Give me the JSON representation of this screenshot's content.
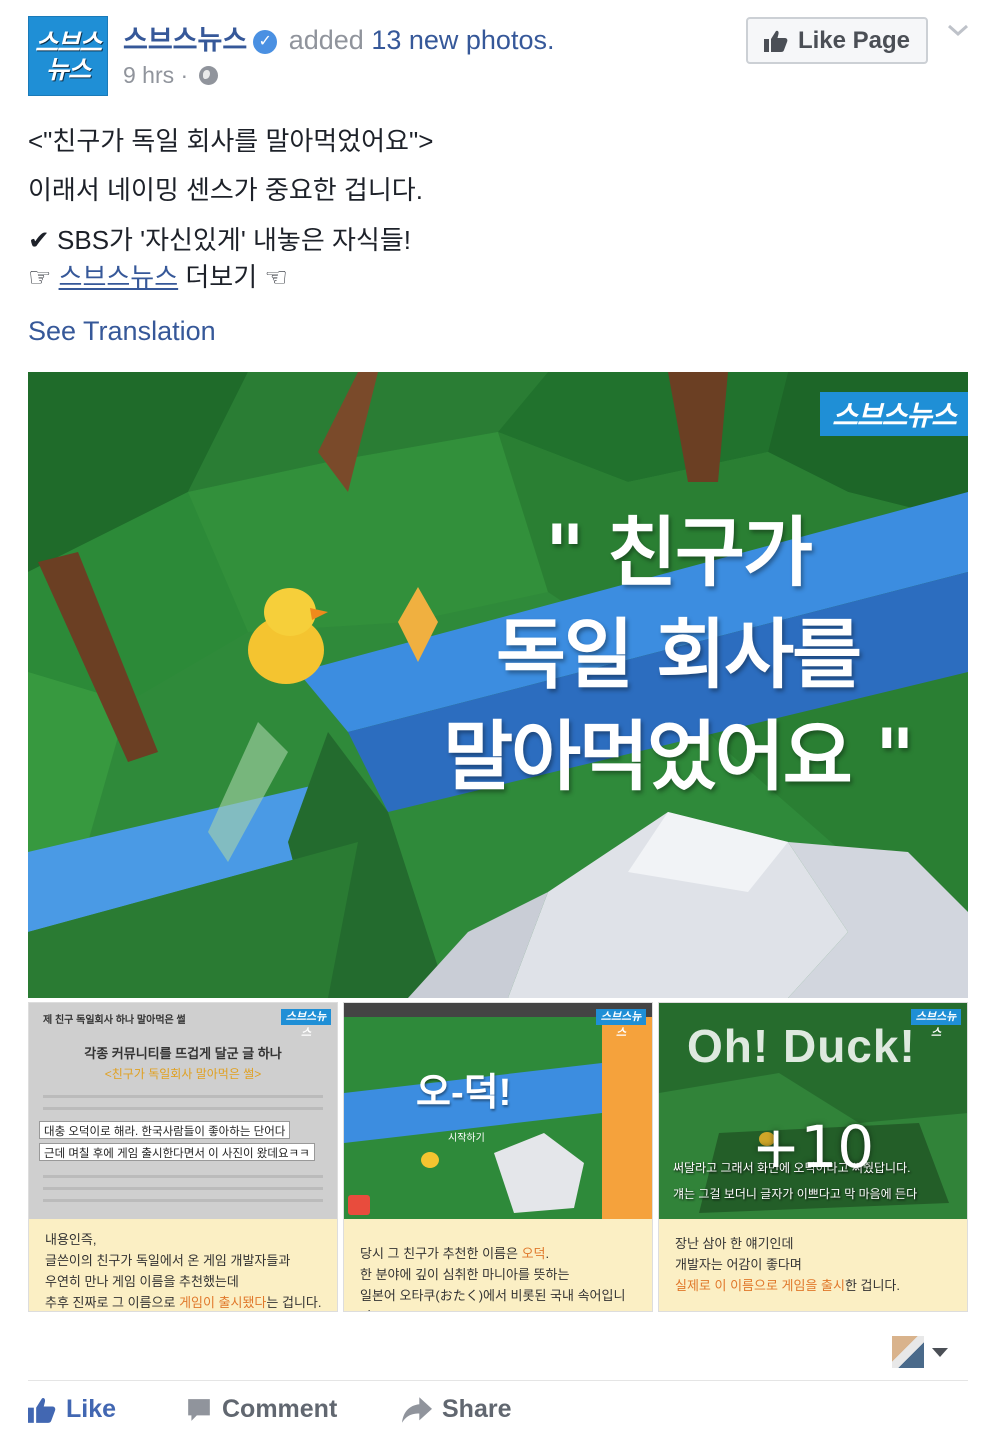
{
  "header": {
    "logo_top": "스브스",
    "logo_bottom": "뉴스",
    "page_name": "스브스뉴스",
    "action_text": "added",
    "photos_link": "13 new photos.",
    "time": "9 hrs",
    "meta_separator": "·",
    "like_page_label": "Like Page",
    "verified_mark": "✓"
  },
  "post": {
    "line1": "<\"친구가 독일 회사를 말아먹었어요\">",
    "line2": "이래서 네이밍 센스가 중요한 겁니다.",
    "line3": "✔ SBS가 '자신있게' 내놓은 자식들!",
    "line4_prefix": "☞ ",
    "line4_link": "스브스뉴스",
    "line4_suffix": " 더보기 ☜",
    "see_translation": "See Translation"
  },
  "main_photo": {
    "badge": "스브스뉴스",
    "headline": [
      "\" 친구가",
      "독일 회사를",
      "말아먹었어요 \""
    ]
  },
  "thumbnails": [
    {
      "badge": "스브스뉴스",
      "sub_title": "제 친구 독일회사 하나 말아먹은 썰",
      "heading": "각종 커뮤니티를 뜨겁게 달군 글 하나",
      "heading2": "<친구가 독일회사 말아먹은 썰>",
      "strip1": "대충 오덕이로 해라. 한국사람들이 좋아하는 단어다",
      "strip2": "근데 며칠 후에 게임 출시한다면서 이 사진이 왔데요ㅋㅋ",
      "caption": [
        {
          "text": "내용인즉,"
        },
        {
          "text": "글쓴이의 친구가 독일에서 온 게임 개발자들과"
        },
        {
          "text": "우연히 만나 게임 이름을 추천했는데"
        },
        {
          "pre": "추후 진짜로 그 이름으로 ",
          "hl": "게임이 출시됐다",
          "post": "는 겁니다."
        }
      ]
    },
    {
      "badge": "스브스뉴스",
      "title": "오-덕!",
      "start": "시작하기",
      "caption": [
        {
          "pre": "당시 그 친구가 추천한 이름은 ",
          "hl": "오덕",
          "post": "."
        },
        {
          "text": "한 분야에 깊이 심취한 마니아를 뜻하는"
        },
        {
          "text": "일본어 오타쿠(おたく)에서 비롯된 국내 속어입니다."
        }
      ]
    },
    {
      "badge": "스브스뉴스",
      "title": "Oh! Duck!",
      "overlay1": "써달라고 그래서 화면에 오덕이라고 써줬답니다.",
      "overlay2": "걔는 그걸 보더니 글자가 이쁘다고 막 마음에 든다",
      "more_count": "+10",
      "caption": [
        {
          "text": "장난 삼아 한 얘기인데"
        },
        {
          "text": "개발자는 어감이 좋다며"
        },
        {
          "pre": "",
          "hl": "실제로 이 이름으로 게임을 출시",
          "post": "한 겁니다."
        }
      ]
    }
  ],
  "actions": {
    "like": "Like",
    "comment": "Comment",
    "share": "Share"
  },
  "icons": [
    "verified-icon",
    "globe-icon",
    "thumbs-up-icon",
    "chevron-down-icon",
    "comment-icon",
    "share-icon"
  ],
  "colors": {
    "link": "#365899",
    "brand_blue": "#1f8fd6",
    "like_blue": "#4267b2",
    "meta_gray": "#90949c",
    "caption_bg": "#fbefc4",
    "highlight_orange": "#e0782b"
  }
}
